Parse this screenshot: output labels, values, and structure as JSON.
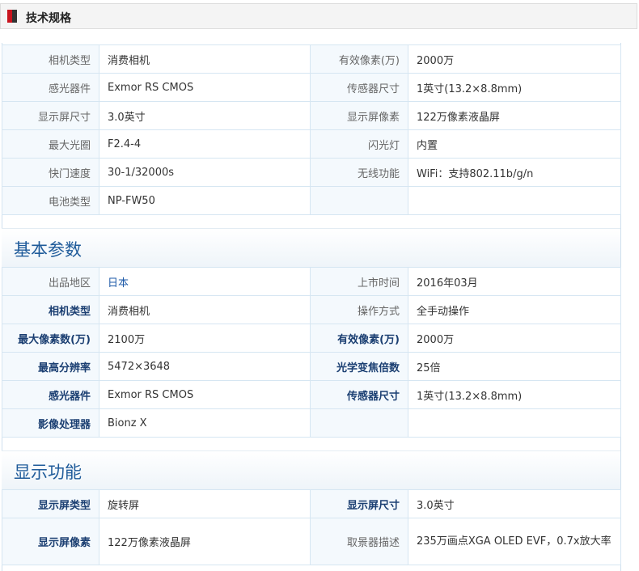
{
  "header": {
    "title": "技术规格"
  },
  "tables": [
    {
      "rows": [
        [
          {
            "k": "相机类型",
            "v": "消费相机"
          },
          {
            "k": "有效像素(万)",
            "v": "2000万"
          }
        ],
        [
          {
            "k": "感光器件",
            "v": "Exmor RS CMOS"
          },
          {
            "k": "传感器尺寸",
            "v": "1英寸(13.2×8.8mm)"
          }
        ],
        [
          {
            "k": "显示屏尺寸",
            "v": "3.0英寸"
          },
          {
            "k": "显示屏像素",
            "v": "122万像素液晶屏"
          }
        ],
        [
          {
            "k": "最大光圈",
            "v": "F2.4-4"
          },
          {
            "k": "闪光灯",
            "v": "内置"
          }
        ],
        [
          {
            "k": "快门速度",
            "v": "30-1/32000s"
          },
          {
            "k": "无线功能",
            "v": "WiFi：支持802.11b/g/n"
          }
        ],
        [
          {
            "k": "电池类型",
            "v": "NP-FW50"
          },
          {
            "k": "",
            "v": ""
          }
        ]
      ]
    },
    {
      "title": "基本参数",
      "rows": [
        [
          {
            "k": "出品地区",
            "v": "日本"
          },
          {
            "k": "上市时间",
            "v": "2016年03月"
          }
        ],
        [
          {
            "k": "相机类型",
            "v": "消费相机"
          },
          {
            "k": "操作方式",
            "v": "全手动操作"
          }
        ],
        [
          {
            "k": "最大像素数(万)",
            "v": "2100万"
          },
          {
            "k": "有效像素(万)",
            "v": "2000万"
          }
        ],
        [
          {
            "k": "最高分辨率",
            "v": "5472×3648"
          },
          {
            "k": "光学变焦倍数",
            "v": "25倍"
          }
        ],
        [
          {
            "k": "感光器件",
            "v": "Exmor RS CMOS"
          },
          {
            "k": "传感器尺寸",
            "v": "1英寸(13.2×8.8mm)"
          }
        ],
        [
          {
            "k": "影像处理器",
            "v": "Bionz X"
          },
          {
            "k": "",
            "v": ""
          }
        ]
      ]
    },
    {
      "title": "显示功能",
      "rows": [
        [
          {
            "k": "显示屏类型",
            "v": "旋转屏"
          },
          {
            "k": "显示屏尺寸",
            "v": "3.0英寸"
          }
        ],
        [
          {
            "k": "显示屏像素",
            "v": "122万像素液晶屏"
          },
          {
            "k": "取景器描述",
            "v": "235万画点XGA OLED EVF，0.7x放大率"
          }
        ]
      ]
    }
  ]
}
